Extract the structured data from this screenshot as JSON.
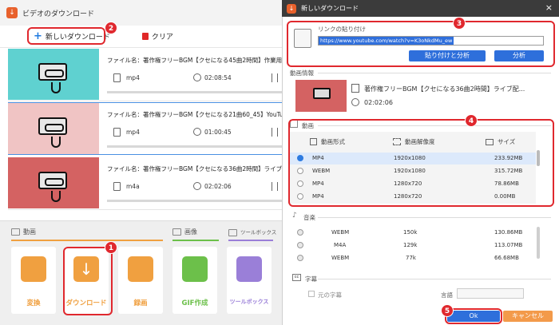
{
  "left_window": {
    "title": "ビデオのダウンロード",
    "toolbar": {
      "new_download": "新しいダウンロード",
      "clear": "クリア"
    },
    "items": [
      {
        "filename": "ファイル名：著作権フリーBGM【クセになる45曲2時間】作業用BGM ライブ配信",
        "format": "mp4",
        "duration": "02:08:54",
        "progress": 0.0,
        "thumb_color": "#5fd1d0",
        "selected": false
      },
      {
        "filename": "ファイル名：著作権フリーBGM【クセになる21曲60_45】YouTube素材 ライブ配",
        "format": "mp4",
        "duration": "01:00:45",
        "progress": 0.0,
        "thumb_color": "#f0c4c4",
        "selected": true
      },
      {
        "filename": "ファイル名：著作権フリーBGM【クセになる36曲2時間】ライブ配信 作業用 勉強",
        "format": "m4a",
        "duration": "02:02:06",
        "progress": 0.0,
        "thumb_color": "#d46262",
        "selected": false
      }
    ],
    "sections": {
      "video": "動画",
      "image": "画像",
      "toolbox": "ツールボックス"
    },
    "tools": [
      {
        "label": "変換",
        "color": "#f0a040",
        "icon": "film-icon"
      },
      {
        "label": "ダウンロード",
        "color": "#f0a040",
        "icon": "download-icon"
      },
      {
        "label": "録画",
        "color": "#f0a040",
        "icon": "screen-record-icon"
      },
      {
        "label": "GIF作成",
        "color": "#6cc04a",
        "icon": "gif-icon"
      },
      {
        "label": "ツールボックス",
        "color": "#9a7fd8",
        "icon": "toolbox-icon"
      }
    ]
  },
  "right_window": {
    "title": "新しいダウンロード",
    "link_label": "リンクの貼り付け",
    "url": "https://www.youtube.com/watch?v=K3oNkdMu_ew",
    "paste_analyze": "貼り付けと分析",
    "analyze": "分析",
    "video_info_label": "動画情報",
    "video_title": "著作権フリーBGM【クセになる36曲2時間】ライブ配...",
    "video_duration": "02:02:06",
    "video_section_label": "動画",
    "video_columns": {
      "format": "動画形式",
      "resolution": "動画解像度",
      "size": "サイズ"
    },
    "video_rows": [
      {
        "format": "MP4",
        "resolution": "1920x1080",
        "size": "233.92MB",
        "selected": true
      },
      {
        "format": "WEBM",
        "resolution": "1920x1080",
        "size": "315.72MB",
        "selected": false
      },
      {
        "format": "MP4",
        "resolution": "1280x720",
        "size": "78.86MB",
        "selected": false
      },
      {
        "format": "MP4",
        "resolution": "1280x720",
        "size": "0.00MB",
        "selected": false
      }
    ],
    "audio_section_label": "音楽",
    "audio_rows": [
      {
        "format": "WEBM",
        "bitrate": "150k",
        "size": "130.86MB"
      },
      {
        "format": "M4A",
        "bitrate": "129k",
        "size": "113.07MB"
      },
      {
        "format": "WEBM",
        "bitrate": "77k",
        "size": "66.68MB"
      }
    ],
    "subtitle_section_label": "字幕",
    "original_subtitle": "元の字幕",
    "language_label": "言語",
    "ok": "Ok",
    "cancel": "キャンセル"
  },
  "badges": [
    "1",
    "2",
    "3",
    "4",
    "5"
  ],
  "colors": {
    "accent_red": "#e0282e",
    "brand_blue": "#2e6fdb",
    "orange": "#f0a040",
    "cancel_orange": "#f39a4a"
  }
}
